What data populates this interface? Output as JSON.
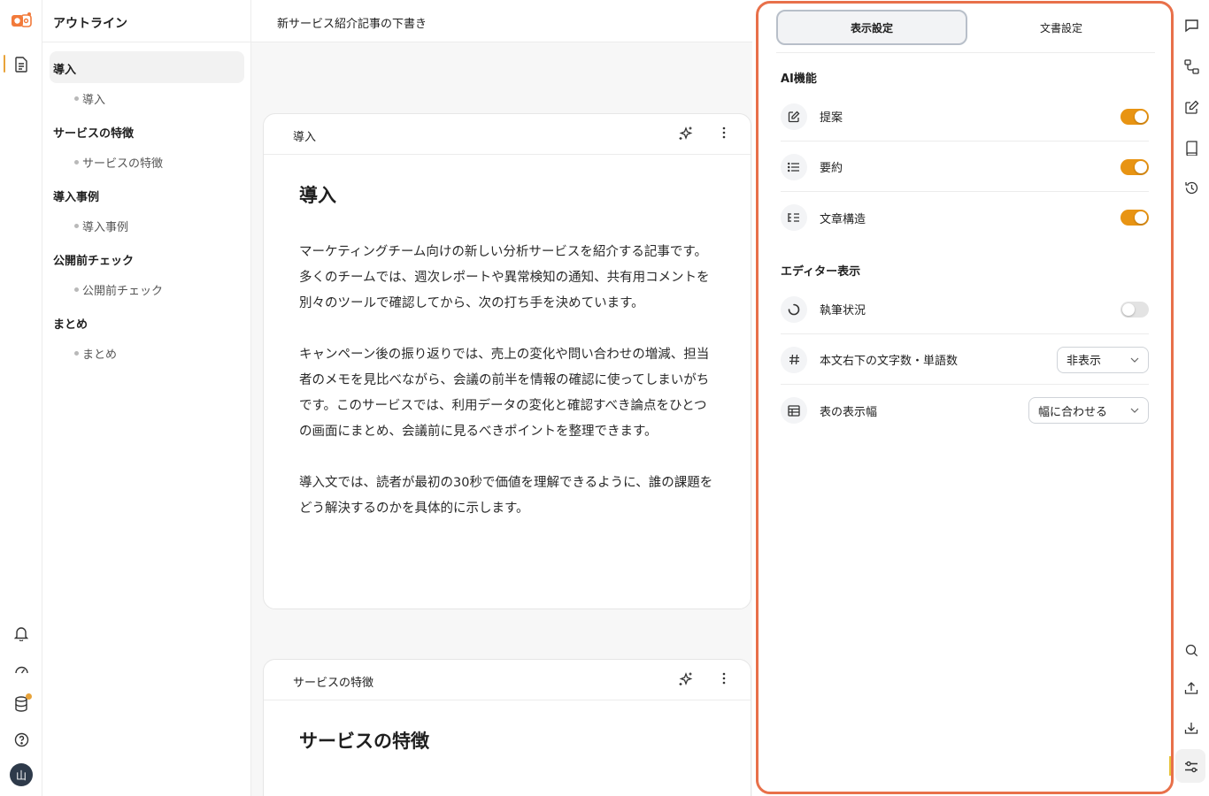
{
  "outline": {
    "title": "アウトライン",
    "sections": [
      {
        "heading": "導入",
        "sub": "導入"
      },
      {
        "heading": "サービスの特徴",
        "sub": "サービスの特徴"
      },
      {
        "heading": "導入事例",
        "sub": "導入事例"
      },
      {
        "heading": "公開前チェック",
        "sub": "公開前チェック"
      },
      {
        "heading": "まとめ",
        "sub": "まとめ"
      }
    ]
  },
  "document": {
    "title": "新サービス紹介記事の下書き",
    "cards": [
      {
        "label": "導入",
        "heading": "導入",
        "paragraphs": [
          "マーケティングチーム向けの新しい分析サービスを紹介する記事です。多くのチームでは、週次レポートや異常検知の通知、共有用コメントを別々のツールで確認してから、次の打ち手を決めています。",
          "キャンペーン後の振り返りでは、売上の変化や問い合わせの増減、担当者のメモを見比べながら、会議の前半を情報の確認に使ってしまいがちです。このサービスでは、利用データの変化と確認すべき論点をひとつの画面にまとめ、会議前に見るべきポイントを整理できます。",
          "導入文では、読者が最初の30秒で価値を理解できるように、誰の課題をどう解決するのかを具体的に示します。"
        ]
      },
      {
        "label": "サービスの特徴",
        "heading": "サービスの特徴"
      }
    ]
  },
  "settings": {
    "tabs": [
      {
        "label": "表示設定",
        "active": true
      },
      {
        "label": "文書設定",
        "active": false
      }
    ],
    "ai_section": "AI機能",
    "ai_rows": [
      {
        "label": "提案",
        "icon": "edit-icon",
        "enabled": true
      },
      {
        "label": "要約",
        "icon": "list-icon",
        "enabled": true
      },
      {
        "label": "文章構造",
        "icon": "structure-icon",
        "enabled": true
      }
    ],
    "editor_section": "エディター表示",
    "writing_status": {
      "label": "執筆状況",
      "icon": "progress-icon",
      "enabled": false
    },
    "word_count": {
      "label": "本文右下の文字数・単語数",
      "icon": "hash-icon",
      "value": "非表示"
    },
    "table_width": {
      "label": "表の表示幅",
      "icon": "table-icon",
      "value": "幅に合わせる"
    }
  },
  "colors": {
    "accent": "#e89413",
    "highlight_border": "#e8704a",
    "badge": "#e8a33a"
  },
  "user": {
    "avatar_initial": "山"
  }
}
